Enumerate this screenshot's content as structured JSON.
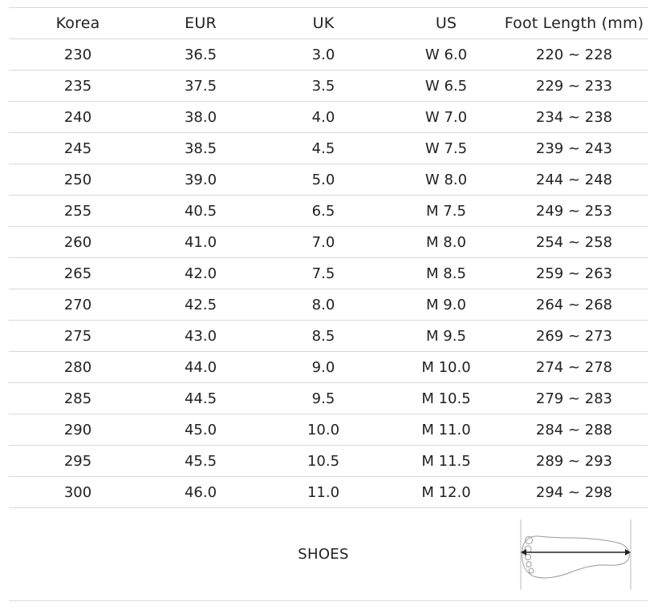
{
  "table": {
    "headers": [
      "Korea",
      "EUR",
      "UK",
      "US",
      "Foot Length (mm)"
    ],
    "rows": [
      [
        "230",
        "36.5",
        "3.0",
        "W 6.0",
        "220 ~ 228"
      ],
      [
        "235",
        "37.5",
        "3.5",
        "W 6.5",
        "229 ~ 233"
      ],
      [
        "240",
        "38.0",
        "4.0",
        "W 7.0",
        "234 ~ 238"
      ],
      [
        "245",
        "38.5",
        "4.5",
        "W 7.5",
        "239 ~ 243"
      ],
      [
        "250",
        "39.0",
        "5.0",
        "W 8.0",
        "244 ~ 248"
      ],
      [
        "255",
        "40.5",
        "6.5",
        "M 7.5",
        "249 ~ 253"
      ],
      [
        "260",
        "41.0",
        "7.0",
        "M 8.0",
        "254 ~ 258"
      ],
      [
        "265",
        "42.0",
        "7.5",
        "M 8.5",
        "259 ~ 263"
      ],
      [
        "270",
        "42.5",
        "8.0",
        "M 9.0",
        "264 ~ 268"
      ],
      [
        "275",
        "43.0",
        "8.5",
        "M 9.5",
        "269 ~ 273"
      ],
      [
        "280",
        "44.0",
        "9.0",
        "M 10.0",
        "274 ~ 278"
      ],
      [
        "285",
        "44.5",
        "9.5",
        "M 10.5",
        "279 ~ 283"
      ],
      [
        "290",
        "45.0",
        "10.0",
        "M 11.0",
        "284 ~ 288"
      ],
      [
        "295",
        "45.5",
        "10.5",
        "M 11.5",
        "289 ~ 293"
      ],
      [
        "300",
        "46.0",
        "11.0",
        "M 12.0",
        "294 ~ 298"
      ]
    ]
  },
  "footer": {
    "label": "SHOES",
    "icon": "foot-length-diagram-icon"
  },
  "colors": {
    "text": "#222222",
    "rule": "#d9d9d9",
    "icon_stroke": "#999999"
  }
}
